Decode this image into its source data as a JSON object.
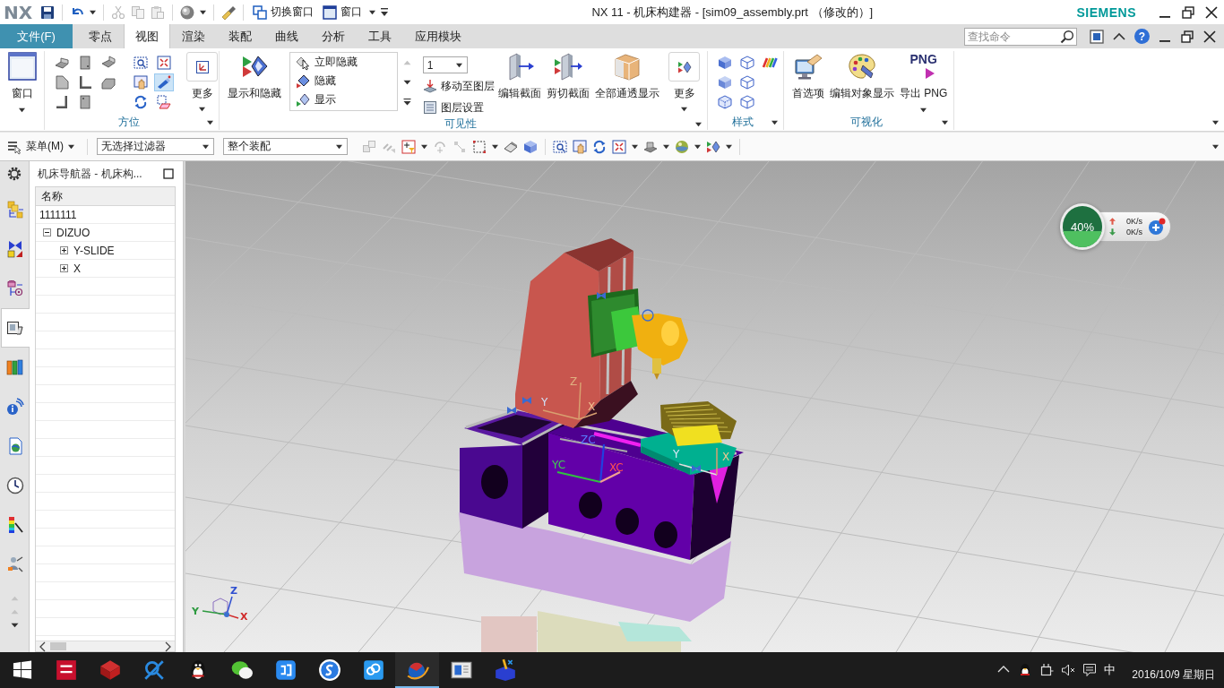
{
  "title_bar": {
    "logo": "NX",
    "quick_access": [
      {
        "label": "切换窗口"
      },
      {
        "label": "窗口"
      }
    ],
    "title": "NX 11 - 机床构建器 - [sim09_assembly.prt （修改的）]",
    "brand": "SIEMENS"
  },
  "ribbon": {
    "file_tab": "文件(F)",
    "tabs": [
      {
        "label": "零点",
        "selected": false
      },
      {
        "label": "视图",
        "selected": true
      },
      {
        "label": "渲染",
        "selected": false
      },
      {
        "label": "装配",
        "selected": false
      },
      {
        "label": "曲线",
        "selected": false
      },
      {
        "label": "分析",
        "selected": false
      },
      {
        "label": "工具",
        "selected": false
      },
      {
        "label": "应用模块",
        "selected": false
      }
    ],
    "search": {
      "placeholder": "查找命令"
    },
    "help": "?",
    "groups": [
      {
        "kind": "window",
        "button": "窗口"
      },
      {
        "kind": "orientation",
        "label": "方位",
        "tools": [
          {
            "on": false
          },
          {
            "on": false
          },
          {
            "on": false
          },
          {
            "on": true
          },
          {
            "on": false
          },
          {
            "on": false
          }
        ],
        "more": "更多"
      },
      {
        "kind": "visibility",
        "label": "可见性",
        "show_hide": "显示和隐藏",
        "list": [
          "立即隐藏",
          "隐藏",
          "显示"
        ],
        "layer": "1",
        "layer_actions": [
          "移动至图层",
          "图层设置"
        ],
        "buttons": [
          "编辑截面",
          "剪切截面",
          "全部通透显示"
        ],
        "more": "更多"
      },
      {
        "kind": "style",
        "label": "样式"
      },
      {
        "kind": "visualize",
        "label": "可视化",
        "buttons": [
          {
            "label": "首选项"
          },
          {
            "label": "编辑对象显示"
          },
          {
            "label": "导出 PNG",
            "icon_text": "PNG"
          }
        ]
      }
    ]
  },
  "toolbar": {
    "menu": "菜单(M)",
    "selection_filter": "无选择过滤器",
    "scope": "整个装配"
  },
  "resource_bar": [
    {
      "selected": false
    },
    {
      "selected": false
    },
    {
      "selected": false
    },
    {
      "selected": true
    },
    {
      "selected": false
    },
    {
      "selected": false
    },
    {
      "selected": false
    },
    {
      "selected": false
    },
    {
      "selected": false
    },
    {
      "selected": false
    }
  ],
  "navigator": {
    "title": "机床导航器 - 机床构...",
    "column": "名称",
    "tree": [
      {
        "name": "1111111"
      },
      {
        "name": "DIZUO",
        "expanded": true,
        "children": [
          {
            "name": "Y-SLIDE",
            "expanded": false
          },
          {
            "name": "X",
            "expanded": false
          }
        ]
      }
    ]
  },
  "viewport": {
    "axis_labels": [
      {
        "text": "Z",
        "color": "#e0b080"
      },
      {
        "text": "Y",
        "color": "#d0e0f8"
      },
      {
        "text": "X",
        "color": "#f0c090"
      },
      {
        "text": "ZC",
        "color": "#5a7aff"
      },
      {
        "text": "YC",
        "color": "#40d050"
      },
      {
        "text": "XC",
        "color": "#ff5050"
      },
      {
        "text": "Y",
        "color": "#e0e8f8"
      },
      {
        "text": "X",
        "color": "#f0c890"
      }
    ],
    "triad_labels": [
      {
        "text": "Z",
        "color": "#2f4fd0"
      },
      {
        "text": "Y",
        "color": "#2e9a40"
      },
      {
        "text": "X",
        "color": "#d02a2a"
      }
    ],
    "net_meter": {
      "percent": "40%",
      "level": 0.4,
      "upload": "0K/s",
      "download": "0K/s"
    }
  },
  "taskbar": {
    "apps": [
      {
        "active": false
      },
      {
        "active": false
      },
      {
        "active": false
      },
      {
        "active": false
      },
      {
        "active": false
      },
      {
        "active": false
      },
      {
        "active": false
      },
      {
        "active": false
      },
      {
        "active": true
      },
      {
        "active": false
      },
      {
        "active": false
      }
    ],
    "ime": "中",
    "date": "2016/10/9 星期日"
  }
}
